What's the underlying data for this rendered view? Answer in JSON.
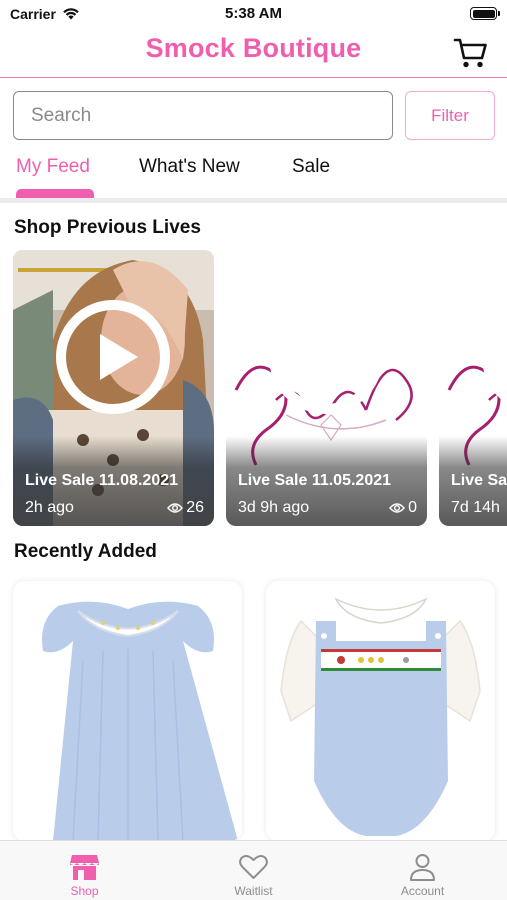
{
  "status_bar": {
    "carrier": "Carrier",
    "time": "5:38 AM"
  },
  "header": {
    "title": "Smock Boutique",
    "cart_icon": "shopping-cart-icon"
  },
  "search": {
    "placeholder": "Search",
    "filter_label": "Filter"
  },
  "tabs": [
    {
      "label": "My Feed",
      "active": true
    },
    {
      "label": "What's New",
      "active": false
    },
    {
      "label": "Sale",
      "active": false
    }
  ],
  "previous_lives": {
    "title": "Shop Previous Lives",
    "items": [
      {
        "title": "Live Sale 11.08.2021",
        "time": "2h ago",
        "views": "26"
      },
      {
        "title": "Live Sale 11.05.2021",
        "time": "3d 9h ago",
        "views": "0"
      },
      {
        "title": "Live Sale",
        "time": "7d 14h",
        "views": ""
      }
    ]
  },
  "recently_added": {
    "title": "Recently Added"
  },
  "tab_bar": [
    {
      "label": "Shop",
      "icon": "storefront-icon",
      "active": true
    },
    {
      "label": "Waitlist",
      "icon": "heart-icon",
      "active": false
    },
    {
      "label": "Account",
      "icon": "person-icon",
      "active": false
    }
  ],
  "colors": {
    "accent": "#ef5fae",
    "filter_border": "#f3a9d0",
    "tab_bar_bg": "#f8f8f8"
  }
}
